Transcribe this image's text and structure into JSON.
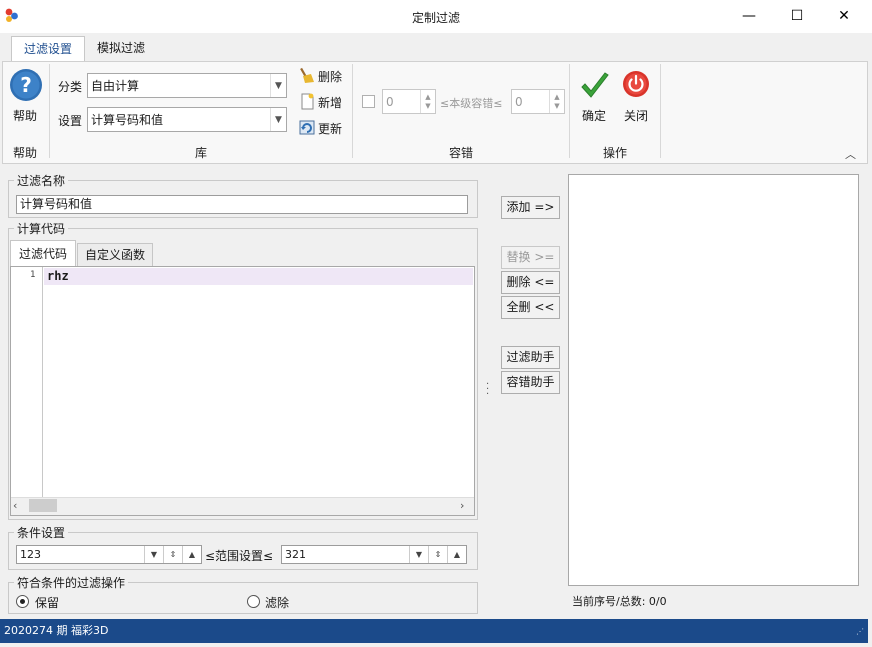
{
  "window": {
    "title": "定制过滤",
    "minimize": "—",
    "maximize": "☐",
    "close": "✕"
  },
  "ribbon": {
    "tabs": [
      {
        "label": "过滤设置",
        "active": true
      },
      {
        "label": "模拟过滤",
        "active": false
      }
    ],
    "help": {
      "label": "帮助",
      "group": "帮助"
    },
    "library": {
      "group": "库",
      "category_label": "分类",
      "category_value": "自由计算",
      "setting_label": "设置",
      "setting_value": "计算号码和值",
      "delete_label": "删除",
      "new_label": "新增",
      "update_label": "更新"
    },
    "tolerance": {
      "group": "容错",
      "min_value": "0",
      "mid_label": "≤本级容错≤",
      "max_value": "0"
    },
    "operation": {
      "group": "操作",
      "ok_label": "确定",
      "close_label": "关闭"
    }
  },
  "filter_name": {
    "legend": "过滤名称",
    "value": "计算号码和值"
  },
  "code": {
    "legend": "计算代码",
    "tabs": [
      {
        "label": "过滤代码",
        "active": true
      },
      {
        "label": "自定义函数",
        "active": false
      }
    ],
    "line_number": "1",
    "line_text": "rhz"
  },
  "side_buttons": {
    "add": "添加 =>",
    "replace": "替换 >=",
    "delete": "删除 <=",
    "delete_all": "全删 <<",
    "filter_helper": "过滤助手",
    "tolerance_helper": "容错助手"
  },
  "condition": {
    "legend": "条件设置",
    "min_value": "123",
    "range_label": "≤范围设置≤",
    "max_value": "321"
  },
  "action": {
    "legend": "符合条件的过滤操作",
    "keep": "保留",
    "remove": "滤除",
    "selected": "keep"
  },
  "list_status": "当前序号/总数: 0/0",
  "statusbar": "2020274 期 福彩3D",
  "colors": {
    "status_bg": "#1b4a8a",
    "accent": "#1f4e8f",
    "help_icon": "#2f6fb3",
    "ok_icon": "#3aa33a",
    "close_icon": "#d9342b"
  }
}
